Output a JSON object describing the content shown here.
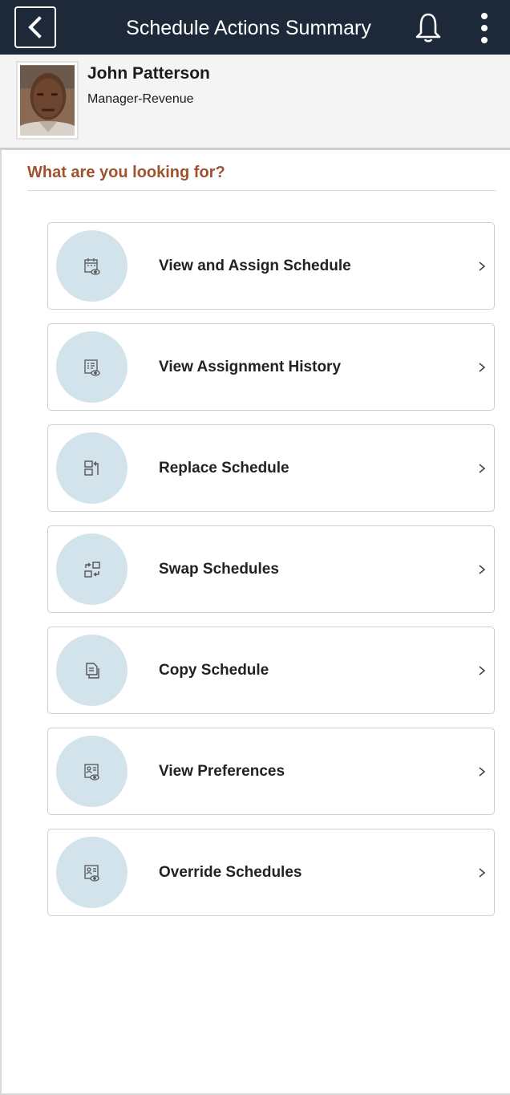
{
  "header": {
    "title": "Schedule Actions Summary",
    "colors": {
      "background": "#1d2939",
      "foreground": "#ffffff"
    },
    "icons": [
      "chevron-left-icon",
      "bell-icon",
      "more-vertical-icon"
    ]
  },
  "profile": {
    "name": "John Patterson",
    "role": "Manager-Revenue"
  },
  "section": {
    "heading": "What are you looking for?",
    "heading_color": "#a0522d"
  },
  "actions": [
    {
      "label": "View and Assign Schedule",
      "icon": "calendar-view-icon"
    },
    {
      "label": "View Assignment History",
      "icon": "list-view-icon"
    },
    {
      "label": "Replace Schedule",
      "icon": "replace-icon"
    },
    {
      "label": "Swap Schedules",
      "icon": "swap-icon"
    },
    {
      "label": "Copy Schedule",
      "icon": "copy-icon"
    },
    {
      "label": "View Preferences",
      "icon": "person-view-icon"
    },
    {
      "label": "Override Schedules",
      "icon": "person-view-icon"
    }
  ],
  "accent": {
    "icon_circle": "#d3e3ec"
  }
}
